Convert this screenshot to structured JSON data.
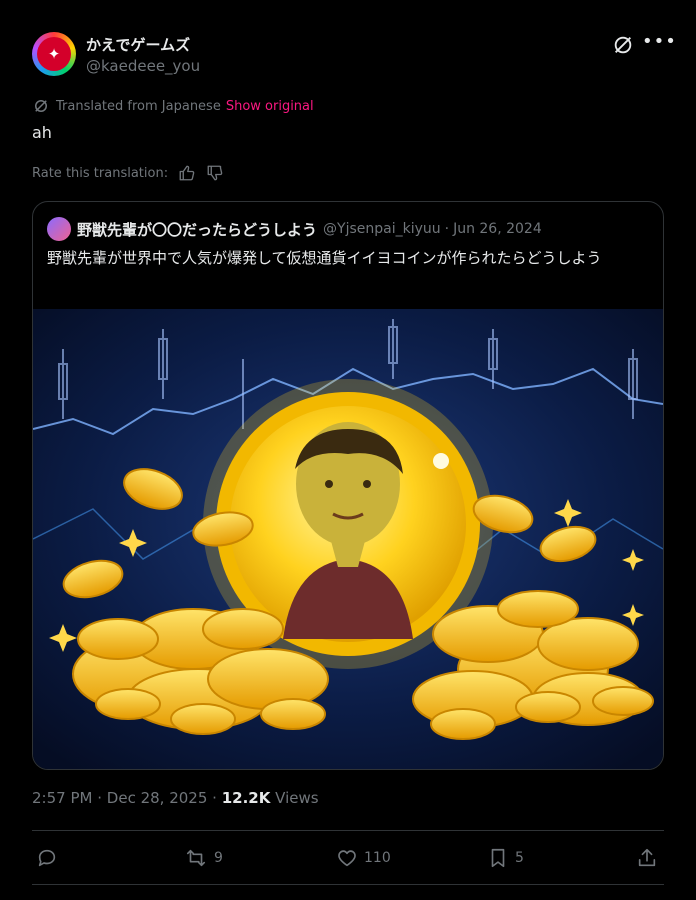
{
  "author": {
    "display_name": "かえでゲームズ",
    "handle": "@kaedeee_you",
    "avatar_icon": "maple-leaf-avatar-icon"
  },
  "translation": {
    "notice": "Translated from Japanese",
    "show_original": "Show original",
    "rate_label": "Rate this translation:"
  },
  "tweet": {
    "text": "ah"
  },
  "quote": {
    "name": "野獣先輩が〇〇だったらどうしよう",
    "handle": "@Yjsenpai_kiyuu",
    "separator": "·",
    "date": "Jun 26, 2024",
    "text": "野獣先輩が世界中で人気が爆発して仮想通貨イイヨコインが作られたらどうしよう",
    "image_icon": "gold-coin-illustration"
  },
  "meta": {
    "time": "2:57 PM",
    "separator": "·",
    "date": "Dec 28, 2025",
    "views_count": "12.2K",
    "views_label": "Views"
  },
  "actions": {
    "reply": "",
    "retweet": "9",
    "like": "110",
    "bookmark": "5"
  },
  "colors": {
    "accent_pink": "#f91880",
    "muted": "#71767b",
    "text": "#e7e9ea",
    "border": "#2f3336",
    "gold": "#f5c518"
  }
}
